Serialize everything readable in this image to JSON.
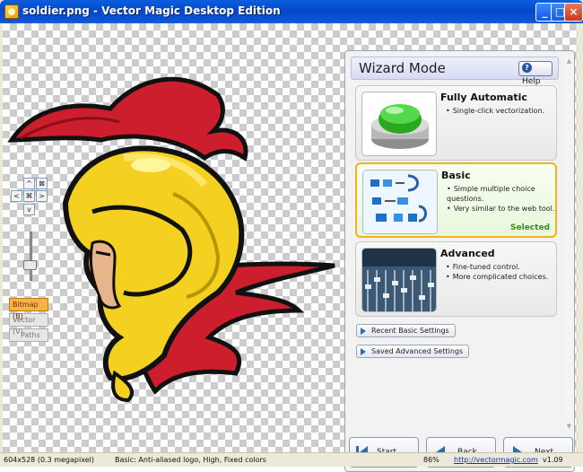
{
  "window": {
    "title": "soldier.png - Vector Magic Desktop Edition",
    "controls": {
      "minimize": "_",
      "maximize": "□",
      "close": "×"
    }
  },
  "canvas": {
    "nav": {
      "up": "^",
      "down": "v",
      "left": "<",
      "right": ">",
      "fit": "⌘",
      "zoom_fit": "⊠"
    },
    "view_toggle": {
      "bitmap": "Bitmap (B)",
      "vector": "Vector (V)",
      "paths": "Paths"
    }
  },
  "wizard": {
    "title": "Wizard Mode",
    "help_label": "Help",
    "options": [
      {
        "title": "Fully Automatic",
        "bullets": [
          "Single-click vectorization."
        ],
        "status": ""
      },
      {
        "title": "Basic",
        "bullets": [
          "Simple multiple choice questions.",
          "Very similar to the web tool."
        ],
        "status": "Selected"
      },
      {
        "title": "Advanced",
        "bullets": [
          "Fine-tuned control.",
          "More complicated choices."
        ],
        "status": ""
      }
    ],
    "recent_basic_label": "Recent Basic Settings",
    "saved_advanced_label": "Saved Advanced Settings",
    "nav": {
      "start": "Start Page",
      "back": "Back",
      "next": "Next"
    }
  },
  "status": {
    "dimensions": "604x528 (0.3 megapixel)",
    "settings": "Basic: Anti-aliased logo, High, Fixed colors",
    "zoom": "86%",
    "url": "http://vectormagic.com",
    "version": "v1.09"
  },
  "colors": {
    "title_bar": "#0a5fe0",
    "accent_selected": "#f2b21a",
    "bitmap_active": "#f7b34a",
    "logo_red": "#cc1e2c",
    "logo_yellow": "#f4d021"
  }
}
